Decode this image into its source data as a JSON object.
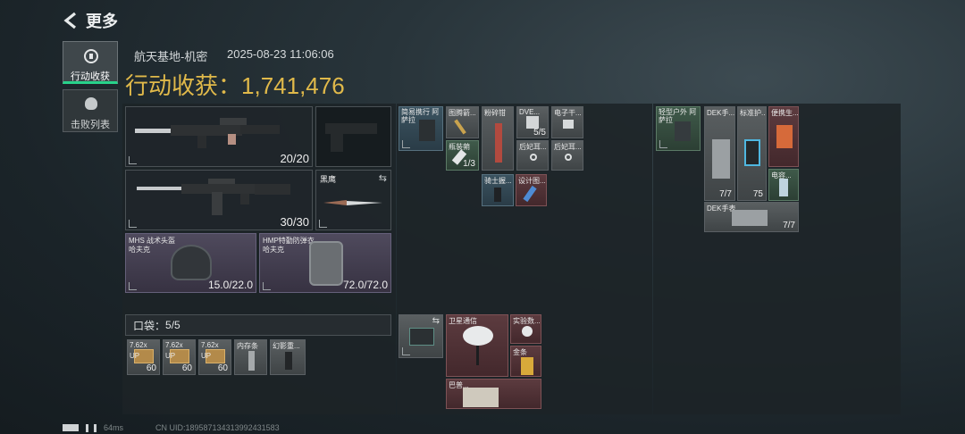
{
  "header": {
    "back_label": "更多"
  },
  "sidebar": {
    "items": [
      {
        "label": "行动收获",
        "active": true
      },
      {
        "label": "击败列表",
        "active": false
      }
    ]
  },
  "summary": {
    "location": "航天基地-机密",
    "datetime": "2025-08-23 11:06:06",
    "title_label": "行动收获：",
    "value": "1,741,476"
  },
  "weapons": {
    "primary_count": "20/20",
    "secondary_count": "30/30",
    "melee_name": "黑鹰"
  },
  "armor": {
    "helmet_name": "MHS 战术头盔",
    "helmet_brand": "哈夫克",
    "helmet_durability": "15.0/22.0",
    "vest_name": "HMP特勤防弹衣",
    "vest_brand": "哈夫克",
    "vest_durability": "72.0/72.0"
  },
  "pocket": {
    "label": "口袋：",
    "count": "5/5",
    "items": [
      {
        "name": "7.62x",
        "sub": "UP",
        "count": "60"
      },
      {
        "name": "7.62x",
        "sub": "UP",
        "count": "60"
      },
      {
        "name": "7.62x",
        "sub": "UP",
        "count": "60"
      },
      {
        "name": "内存条",
        "sub": "",
        "count": ""
      },
      {
        "name": "幻影重...",
        "sub": "",
        "count": ""
      }
    ]
  },
  "rig": {
    "items": [
      {
        "name": "简易携行 阿萨拉"
      },
      {
        "name": "图腾箭..."
      },
      {
        "name": "粉碎钳"
      },
      {
        "name": "DVE..."
      },
      {
        "name": "电子干..."
      },
      {
        "name": "瓶装蒴",
        "count": "1/3"
      },
      {
        "name": "",
        "count": "5/5"
      },
      {
        "name": "后妃耳..."
      },
      {
        "name": "后妃耳..."
      },
      {
        "name": "骑士握..."
      },
      {
        "name": "设计图..."
      }
    ]
  },
  "backpack": {
    "items": [
      {
        "name": "卫星通信"
      },
      {
        "name": "实验数..."
      },
      {
        "name": "金条"
      },
      {
        "name": "巴普..."
      }
    ]
  },
  "case": {
    "items": [
      {
        "name": "轻型户外 阿萨拉"
      },
      {
        "name": "DEK手..."
      },
      {
        "name": "标准护..."
      },
      {
        "name": "便携生..."
      },
      {
        "name": "电容..."
      },
      {
        "name": "DEK手表",
        "count": "7/7"
      },
      {
        "name": "",
        "count": "7/7"
      },
      {
        "name": "",
        "count": "75"
      }
    ]
  },
  "footer": {
    "ping": "64ms",
    "uid": "CN UID:1895871343139924315​83"
  }
}
